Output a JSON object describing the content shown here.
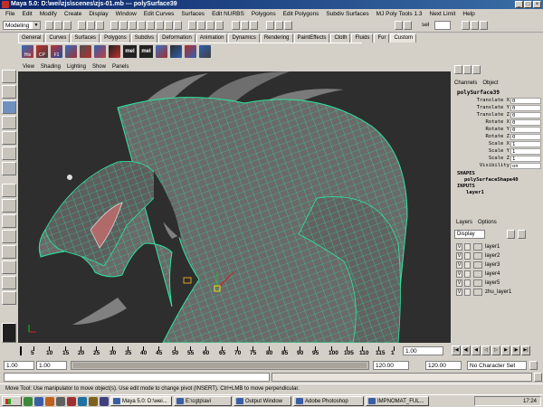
{
  "window": {
    "title": "Maya 5.0: D:\\wei\\zjs\\scenes\\zjs-01.mb  ---  polySurface39",
    "buttons": [
      "_",
      "□",
      "×"
    ]
  },
  "menubar": [
    "File",
    "Edit",
    "Modify",
    "Create",
    "Display",
    "Window",
    "Edit Curves",
    "Surfaces",
    "Edit NURBS",
    "Polygons",
    "Edit Polygons",
    "Subdiv Surfaces",
    "MJ Poly Tools 1.3",
    "Next Limit",
    "Help"
  ],
  "statusline": {
    "mode": "Modeling",
    "sel_label": "sel"
  },
  "shelf": {
    "tabs": [
      "General",
      "Curves",
      "Surfaces",
      "Polygons",
      "Subdivs",
      "Deformation",
      "Animation",
      "Dynamics",
      "Rendering",
      "PaintEffects",
      "Cloth",
      "Fluids",
      "Fur",
      "Custom"
    ],
    "active_tab": "Custom",
    "icons": [
      "",
      "",
      "",
      "",
      "",
      "",
      "",
      "mel",
      "mel"
    ],
    "icon_labels": [
      "His",
      "CP",
      "F1"
    ]
  },
  "viewport": {
    "menu": [
      "View",
      "Shading",
      "Lighting",
      "Show",
      "Panels"
    ]
  },
  "channelbox": {
    "menu": [
      "Channels",
      "Object"
    ],
    "object": "polySurface39",
    "attributes": [
      {
        "label": "Translate X",
        "value": "0"
      },
      {
        "label": "Translate Y",
        "value": "0"
      },
      {
        "label": "Translate Z",
        "value": "0"
      },
      {
        "label": "Rotate X",
        "value": "0"
      },
      {
        "label": "Rotate Y",
        "value": "0"
      },
      {
        "label": "Rotate Z",
        "value": "0"
      },
      {
        "label": "Scale X",
        "value": "1"
      },
      {
        "label": "Scale Y",
        "value": "1"
      },
      {
        "label": "Scale Z",
        "value": "1"
      },
      {
        "label": "Visibility",
        "value": "on"
      }
    ],
    "shapes_header": "SHAPES",
    "shape_name": "polySurfaceShape40",
    "inputs_header": "INPUTS",
    "input_name": "layer1"
  },
  "layers": {
    "menu": [
      "Layers",
      "Options"
    ],
    "display": "Display",
    "items": [
      {
        "v": "V",
        "name": "layer1"
      },
      {
        "v": "V",
        "name": "layer2"
      },
      {
        "v": "V",
        "name": "layer3"
      },
      {
        "v": "V",
        "name": "layer4"
      },
      {
        "v": "V",
        "name": "layer5"
      },
      {
        "v": "V",
        "name": "zhu_layer1"
      }
    ]
  },
  "timeline": {
    "ticks": [
      "5",
      "10",
      "15",
      "20",
      "25",
      "30",
      "35",
      "40",
      "45",
      "50",
      "55",
      "60",
      "65",
      "70",
      "75",
      "80",
      "85",
      "90",
      "95",
      "100",
      "105",
      "110",
      "115",
      "1"
    ],
    "current_frame": "1.00",
    "range_start": "1.00",
    "range_start2": "1.00",
    "range_end": "120.00",
    "range_end2": "120.00",
    "character_set": "No Character Set"
  },
  "helpline": "Move Tool: Use manipulator to move object(s). Use edit mode to change pivot (INSERT).  Ctrl+LMB to move perpendicular.",
  "taskbar": {
    "tasks": [
      "Maya 5.0: D:\\wei...",
      "E:\\cgtp\\avi",
      "Output Window",
      "Adobe Photoshop",
      "IMPNOMAT_FUL..."
    ],
    "active_task": 0,
    "clock": "17:24"
  }
}
